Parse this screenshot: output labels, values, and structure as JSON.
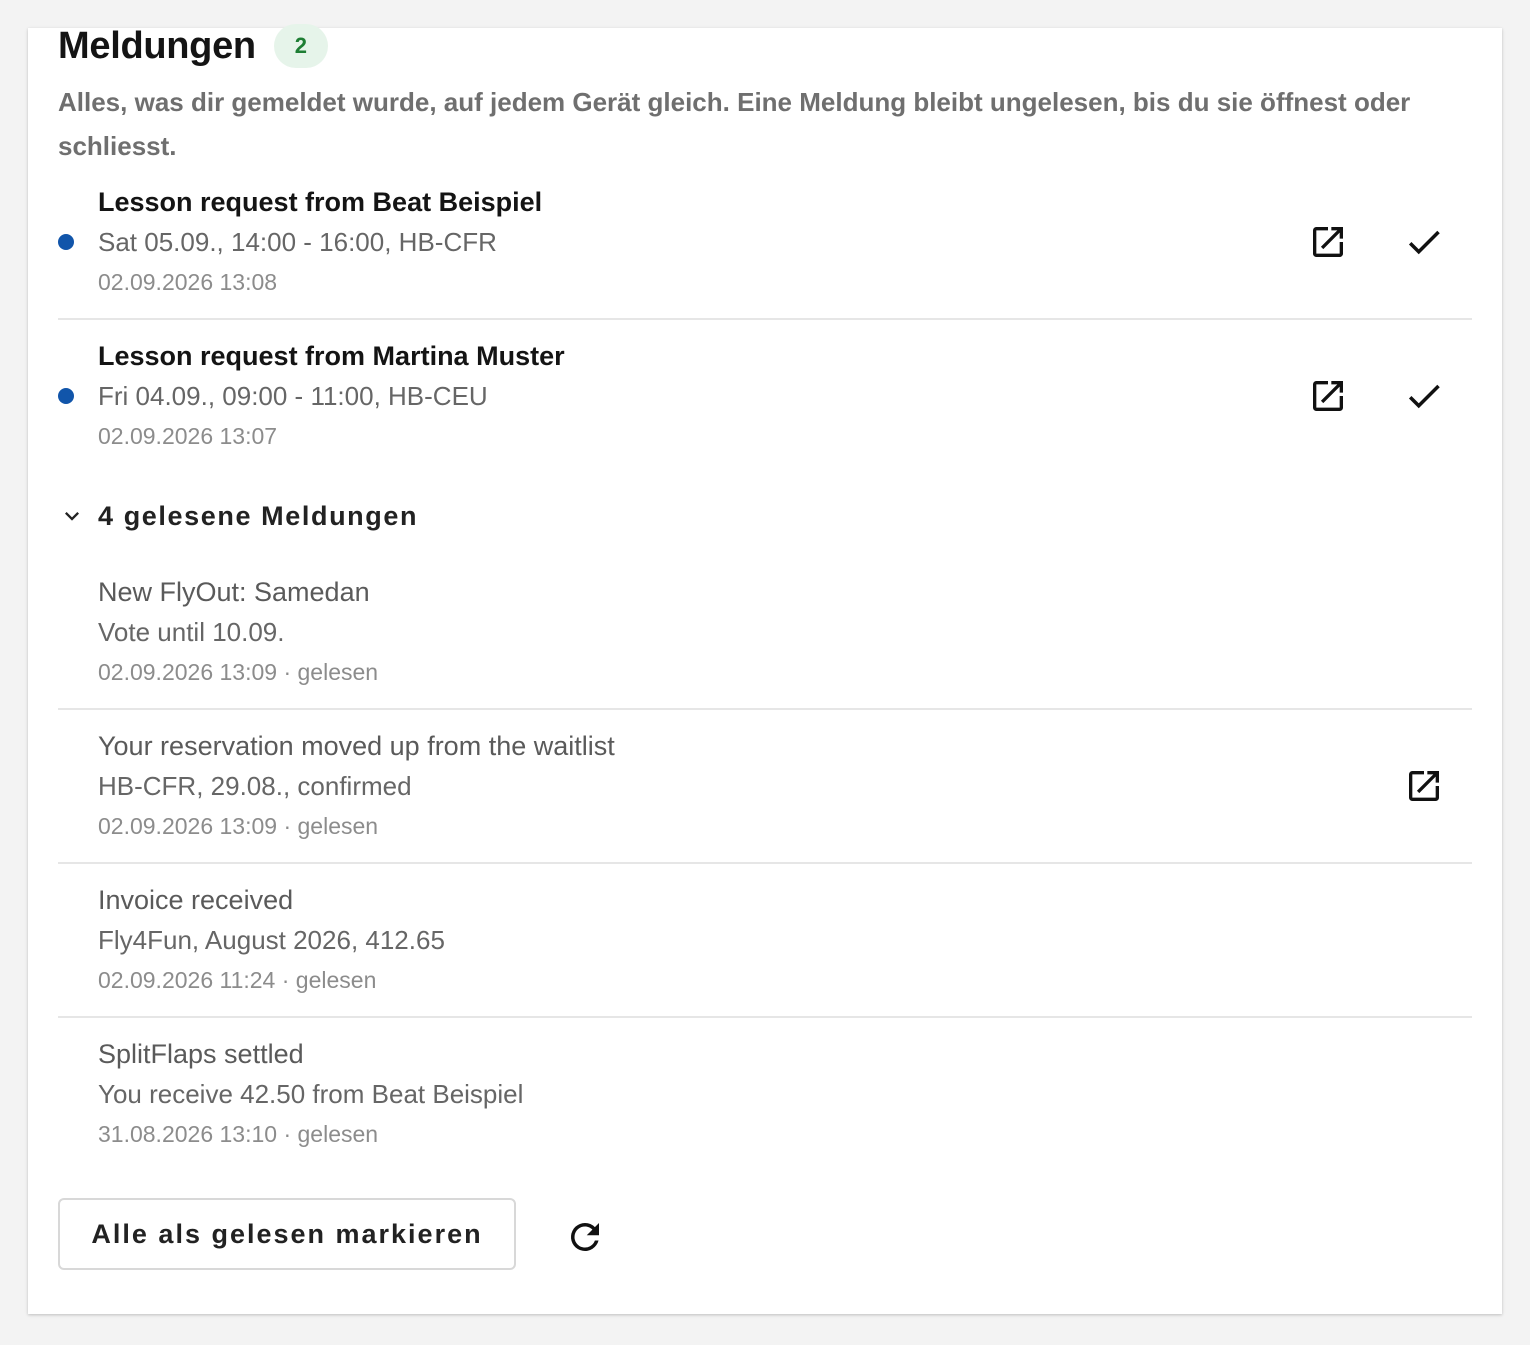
{
  "header": {
    "title": "Meldungen",
    "unread_count": "2",
    "description": "Alles, was dir gemeldet wurde, auf jedem Gerät gleich. Eine Meldung bleibt ungelesen, bis du sie öffnest oder schliesst."
  },
  "unread": [
    {
      "title": "Lesson request from Beat Beispiel",
      "subtitle": "Sat 05.09., 14:00 - 16:00, HB-CFR",
      "time": "02.09.2026 13:08",
      "open_icon": "open-in-new-icon",
      "mark_read_icon": "check-icon"
    },
    {
      "title": "Lesson request from Martina Muster",
      "subtitle": "Fri 04.09., 09:00 - 11:00, HB-CEU",
      "time": "02.09.2026 13:07",
      "open_icon": "open-in-new-icon",
      "mark_read_icon": "check-icon"
    }
  ],
  "read_section": {
    "toggle_label": "4 gelesene Meldungen",
    "toggle_icon": "chevron-down-icon",
    "items": [
      {
        "title": "New FlyOut: Samedan",
        "subtitle": "Vote until 10.09.",
        "time": "02.09.2026 13:09 · gelesen"
      },
      {
        "title": "Your reservation moved up from the waitlist",
        "subtitle": "HB-CFR, 29.08., confirmed",
        "time": "02.09.2026 13:09 · gelesen",
        "open_icon": "open-in-new-icon"
      },
      {
        "title": "Invoice received",
        "subtitle": "Fly4Fun, August 2026, 412.65",
        "time": "02.09.2026 11:24 · gelesen"
      },
      {
        "title": "SplitFlaps settled",
        "subtitle": "You receive 42.50 from Beat Beispiel",
        "time": "31.08.2026 13:10 · gelesen"
      }
    ]
  },
  "footer": {
    "mark_all_label": "Alle als gelesen markieren",
    "refresh_icon": "refresh-icon"
  },
  "colors": {
    "unread_dot": "#1155aa",
    "badge_bg": "#e6f4ea",
    "badge_text": "#1e7e34"
  }
}
